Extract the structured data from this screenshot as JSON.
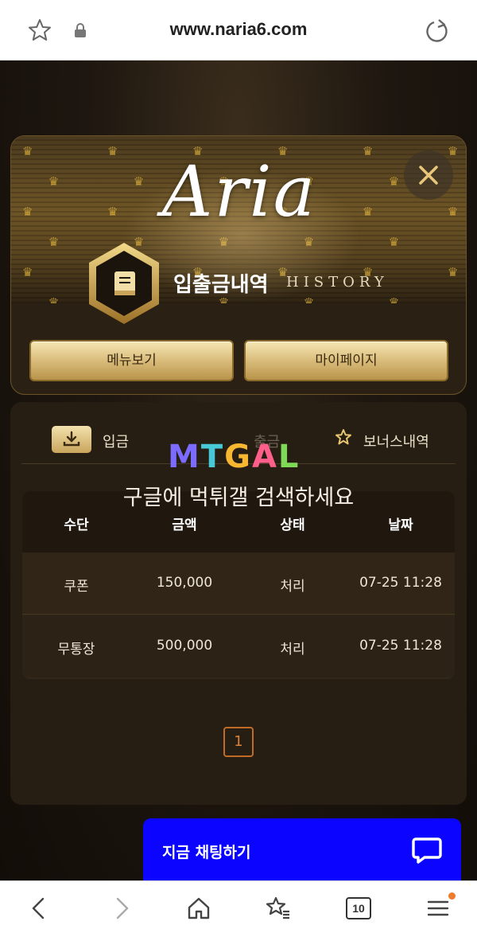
{
  "browser": {
    "url": "www.naria6.com",
    "tabs_count": "10"
  },
  "modal": {
    "logo": "Aria",
    "title": "입출금내역",
    "subtitle": "HISTORY",
    "menu_button": "메뉴보기",
    "mypage_button": "마이페이지"
  },
  "tabs": {
    "deposit": "입금",
    "withdraw": "출금",
    "bonus": "보너스내역"
  },
  "watermark": {
    "letters": [
      "M",
      "T",
      "G",
      "A",
      "L"
    ],
    "notice": "구글에 먹튀갤 검색하세요"
  },
  "table": {
    "headers": [
      "수단",
      "금액",
      "상태",
      "날짜"
    ],
    "rows": [
      [
        "쿠폰",
        "150,000",
        "처리",
        "07-25 11:28"
      ],
      [
        "무통장",
        "500,000",
        "처리",
        "07-25 11:28"
      ]
    ]
  },
  "pagination": {
    "current": "1"
  },
  "chat": {
    "label": "지금 채팅하기"
  },
  "colors": {
    "accent_gold": "#d4a93a",
    "chat_blue": "#0b05ff",
    "page_orange": "#c06a26"
  }
}
